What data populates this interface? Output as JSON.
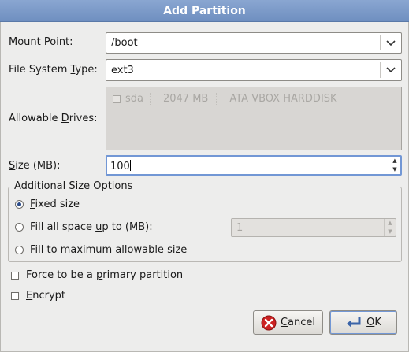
{
  "dialog": {
    "title": "Add Partition"
  },
  "mount_point": {
    "label_a": "M",
    "label_b": "ount Point:",
    "value": "/boot"
  },
  "fs_type": {
    "label_a": "File System ",
    "label_b": "T",
    "label_c": "ype:",
    "value": "ext3"
  },
  "drives": {
    "label_a": "Allowable ",
    "label_b": "D",
    "label_c": "rives:",
    "rows": [
      {
        "name": "sda",
        "size": "2047 MB",
        "model": "ATA VBOX HARDDISK"
      }
    ]
  },
  "size": {
    "label_a": "S",
    "label_b": "ize (MB):",
    "value": "100"
  },
  "additional": {
    "legend": "Additional Size Options",
    "fixed_a": "F",
    "fixed_b": "ixed size",
    "fill_up_a": "Fill all space ",
    "fill_up_b": "u",
    "fill_up_c": "p to (MB):",
    "fill_up_value": "1",
    "fill_max_a": "Fill to maximum ",
    "fill_max_b": "a",
    "fill_max_c": "llowable size"
  },
  "primary": {
    "a": "Force to be a ",
    "b": "p",
    "c": "rimary partition"
  },
  "encrypt": {
    "a": "E",
    "b": "ncrypt"
  },
  "buttons": {
    "cancel_a": "C",
    "cancel_b": "ancel",
    "ok_a": "O",
    "ok_b": "K"
  },
  "colors": {
    "title_bar": "#7b98c8",
    "focus": "#7297d5",
    "cancel_icon": "#cc2222"
  },
  "icons": {
    "dropdown": "chevron-down-icon",
    "cancel": "cancel-icon",
    "ok": "ok-icon"
  }
}
